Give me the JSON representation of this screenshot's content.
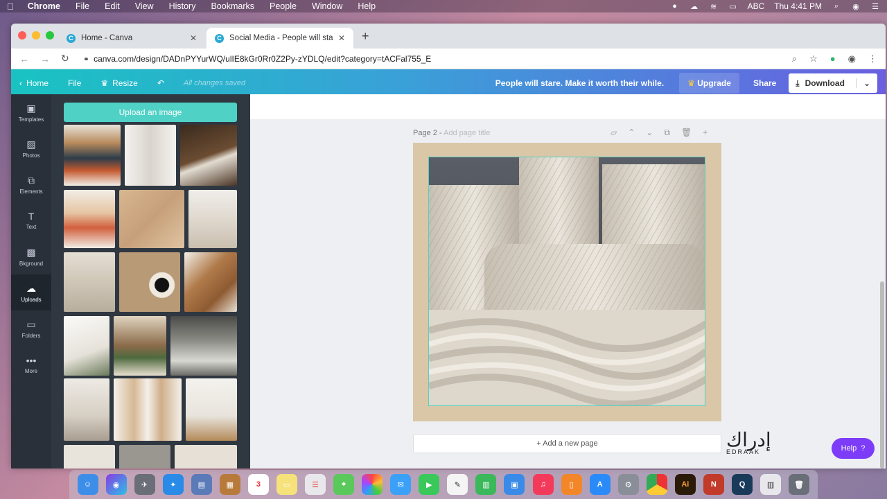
{
  "menubar": {
    "app": "Chrome",
    "items": [
      "File",
      "Edit",
      "View",
      "History",
      "Bookmarks",
      "People",
      "Window",
      "Help"
    ],
    "input_source": "ABC",
    "clock": "Thu 4:41 PM"
  },
  "browser": {
    "tabs": [
      {
        "title": "Home - Canva"
      },
      {
        "title": "Social Media - People will stare"
      }
    ],
    "url": "canva.com/design/DADnPYYurWQ/ulIE8kGr0Rr0Z2Py-zYDLQ/edit?category=tACFal755_E"
  },
  "header": {
    "home": "Home",
    "file": "File",
    "resize": "Resize",
    "saved": "All changes saved",
    "slogan": "People will stare. Make it worth their while.",
    "upgrade": "Upgrade",
    "share": "Share",
    "download": "Download"
  },
  "sidebar": {
    "items": [
      {
        "label": "Templates",
        "icon": "templates-icon"
      },
      {
        "label": "Photos",
        "icon": "photos-icon"
      },
      {
        "label": "Elements",
        "icon": "elements-icon"
      },
      {
        "label": "Text",
        "icon": "text-icon"
      },
      {
        "label": "Bkground",
        "icon": "background-icon"
      },
      {
        "label": "Uploads",
        "icon": "uploads-icon"
      },
      {
        "label": "Folders",
        "icon": "folders-icon"
      },
      {
        "label": "More",
        "icon": "more-icon"
      }
    ],
    "active": "Uploads"
  },
  "uploads": {
    "button": "Upload an image"
  },
  "canvas": {
    "page_label": "Page 2 -",
    "page_title_placeholder": "Add page title",
    "add_page": "+ Add a new page"
  },
  "overlay": {
    "help": "Help",
    "help_mark": "?",
    "watermark": "إدراك",
    "watermark_sub": "EDRAAK"
  },
  "colors": {
    "accent": "#4fd1c5",
    "help": "#7d3cf8",
    "page_bg": "#d9c7a8"
  }
}
